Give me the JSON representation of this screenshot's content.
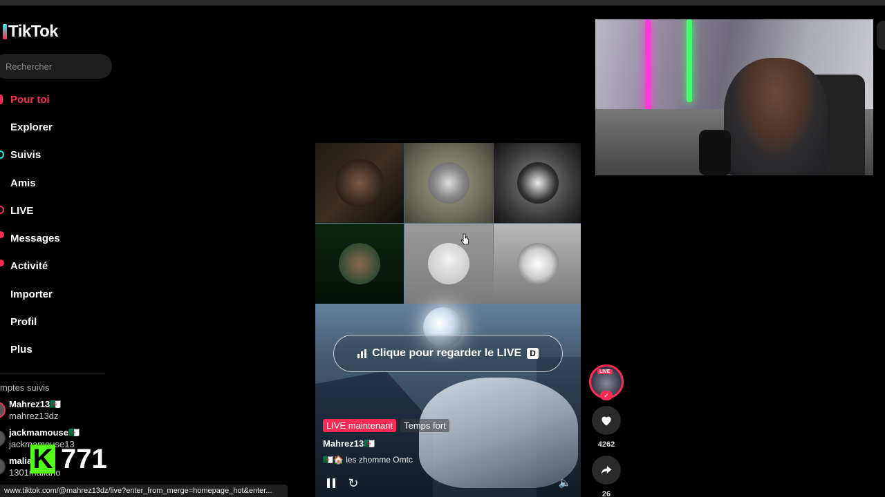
{
  "app": {
    "name": "TikTok"
  },
  "search": {
    "placeholder": "Rechercher"
  },
  "nav": {
    "for_you": "Pour toi",
    "explore": "Explorer",
    "following": "Suivis",
    "friends": "Amis",
    "live": "LIVE",
    "messages": "Messages",
    "activity": "Activité",
    "upload": "Importer",
    "profile": "Profil",
    "more": "Plus"
  },
  "followed": {
    "title": "mptes suivis",
    "accounts": [
      {
        "name": "Mahrez13🇩🇿",
        "handle": "mahrez13dz"
      },
      {
        "name": "jackmamouse🇩🇿",
        "handle": "jackmamouse13"
      },
      {
        "name": "malia",
        "handle": "1301maliano"
      }
    ]
  },
  "overlay": {
    "kick_count": "771",
    "kick_letter": "K"
  },
  "video": {
    "cta_label": "Clique pour regarder le LIVE",
    "cta_key": "D",
    "tag_live": "LIVE maintenant",
    "tag_highlight": "Temps fort",
    "author": "Mahrez13🇩🇿",
    "description": "🇩🇿🏠 les zhomme Omtc"
  },
  "actions": {
    "live_badge": "LIVE",
    "likes": "4262",
    "shares": "26"
  },
  "status_bar": {
    "url": "www.tiktok.com/@mahrez13dz/live?enter_from_merge=homepage_hot&enter..."
  },
  "colors": {
    "accent": "#fe2c55",
    "cyan": "#25f4ee",
    "kick_green": "#53fc18"
  },
  "icons": [
    "tiktok-logo-icon",
    "home-icon",
    "explore-icon",
    "following-icon",
    "friends-icon",
    "live-icon",
    "messages-icon",
    "activity-icon",
    "upload-icon",
    "profile-icon",
    "more-icon",
    "signal-bars-icon",
    "pause-icon",
    "replay-icon",
    "volume-icon",
    "heart-icon",
    "share-icon",
    "cursor-icon"
  ]
}
